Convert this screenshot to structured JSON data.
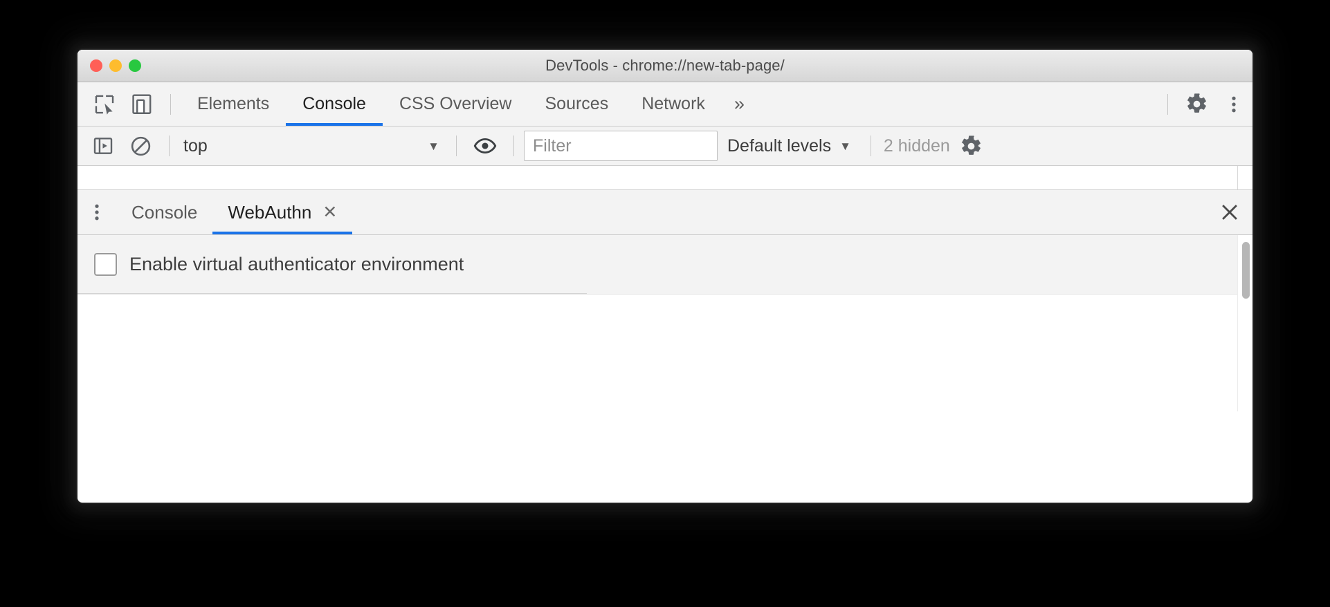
{
  "window": {
    "title": "DevTools - chrome://new-tab-page/",
    "traffic_lights": {
      "close": "close-window",
      "minimize": "minimize-window",
      "zoom": "zoom-window"
    }
  },
  "main_toolbar": {
    "inspect_icon": "inspect-element-icon",
    "device_icon": "device-toolbar-icon",
    "settings_icon": "gear-icon",
    "more_icon": "kebab-menu-icon",
    "more_tabs_label": "»"
  },
  "main_tabs": [
    {
      "label": "Elements",
      "active": false
    },
    {
      "label": "Console",
      "active": true
    },
    {
      "label": "CSS Overview",
      "active": false
    },
    {
      "label": "Sources",
      "active": false
    },
    {
      "label": "Network",
      "active": false
    }
  ],
  "console_toolbar": {
    "sidebar_icon": "console-sidebar-icon",
    "clear_icon": "clear-console-icon",
    "context": "top",
    "context_caret": "▼",
    "eye_icon": "live-expression-icon",
    "filter_placeholder": "Filter",
    "filter_value": "",
    "levels_label": "Default levels",
    "levels_caret": "▼",
    "hidden_count": "2 hidden",
    "settings_icon": "gear-icon"
  },
  "drawer": {
    "menu_icon": "kebab-menu-icon",
    "close_icon": "close-drawer-icon",
    "tabs": [
      {
        "label": "Console",
        "active": false,
        "closable": false
      },
      {
        "label": "WebAuthn",
        "active": true,
        "closable": true,
        "close_glyph": "✕"
      }
    ]
  },
  "webauthn": {
    "enable_label": "Enable virtual authenticator environment",
    "enable_checked": false
  },
  "colors": {
    "accent": "#1a73e8",
    "toolbar_bg": "#f3f3f3",
    "titlebar_bg": "#e6e6e6",
    "border": "#cdcdcd",
    "text": "#5a5a5a",
    "text_active": "#202020",
    "muted": "#9a9a9a",
    "traffic_red": "#ff5f57",
    "traffic_yellow": "#febc2e",
    "traffic_green": "#28c840",
    "page_bg": "#000000"
  }
}
